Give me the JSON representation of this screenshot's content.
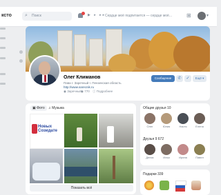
{
  "topbar": {
    "logo": "ксто",
    "search_placeholder": "Поиск",
    "track": "Сердце моё подпитается — сердце моё...",
    "player": "▶ ▸ ▸▸"
  },
  "profile": {
    "name": "Олег Климанов",
    "subtitle": "Пава I. Заречный I. Пензенская область",
    "link": "http://www.sarecnik.ru",
    "meta": [
      "Заречный",
      "770",
      "Подробнее"
    ],
    "primary_button": "Сообщение",
    "more_button": "Ещё"
  },
  "photos": {
    "tabs": [
      "Фото",
      "Музыка"
    ],
    "show_all": "Показать всё",
    "logo_text": [
      "Новых",
      "Созидате"
    ]
  },
  "friends": {
    "title": "Общие друзья 10",
    "items": [
      "Олег",
      "Юлия",
      "Настя",
      "Елена"
    ]
  },
  "friends2": {
    "title": "Друзья 9 672",
    "items": [
      "Денис",
      "Илья",
      "Ирина",
      "Павел"
    ]
  },
  "gifts": {
    "title": "Подарки 339"
  },
  "colors": {
    "accent": "#447bba",
    "bg": "#edeef0"
  }
}
